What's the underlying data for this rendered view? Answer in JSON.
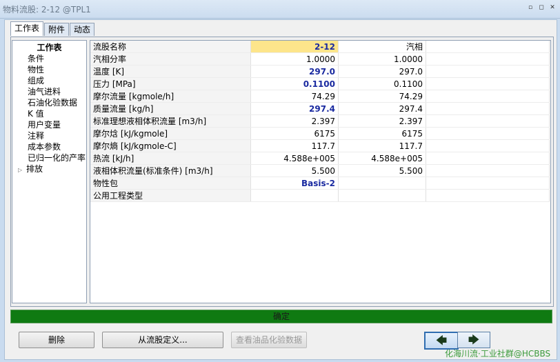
{
  "window": {
    "title": "物料流股: 2-12 @TPL1",
    "min": "▫",
    "restore": "◻",
    "close": "✕"
  },
  "tabs": [
    {
      "label": "工作表"
    },
    {
      "label": "附件"
    },
    {
      "label": "动态"
    }
  ],
  "tree": {
    "header": "工作表",
    "items": [
      "条件",
      "物性",
      "组成",
      "油气进料",
      "石油化验数据",
      "K 值",
      "用户变量",
      "注释",
      "成本参数",
      "已归一化的产率",
      "排放"
    ]
  },
  "grid": {
    "rows": [
      {
        "label": "流股名称",
        "v1": "2-12",
        "v2": "汽相"
      },
      {
        "label": "汽相分率",
        "v1": "1.0000",
        "v2": "1.0000"
      },
      {
        "label": "温度 [K]",
        "v1": "297.0",
        "v2": "297.0"
      },
      {
        "label": "压力 [MPa]",
        "v1": "0.1100",
        "v2": "0.1100"
      },
      {
        "label": "摩尔流量 [kgmole/h]",
        "v1": "74.29",
        "v2": "74.29"
      },
      {
        "label": "质量流量 [kg/h]",
        "v1": "297.4",
        "v2": "297.4"
      },
      {
        "label": "标准理想液相体积流量 [m3/h]",
        "v1": "2.397",
        "v2": "2.397"
      },
      {
        "label": "摩尔焓 [kJ/kgmole]",
        "v1": "6175",
        "v2": "6175"
      },
      {
        "label": "摩尔熵 [kJ/kgmole-C]",
        "v1": "117.7",
        "v2": "117.7"
      },
      {
        "label": "热流 [kJ/h]",
        "v1": "4.588e+005",
        "v2": "4.588e+005"
      },
      {
        "label": "液相体积流量(标准条件) [m3/h]",
        "v1": "5.500",
        "v2": "5.500"
      },
      {
        "label": "物性包",
        "v1": "Basis-2",
        "v2": ""
      },
      {
        "label": "公用工程类型",
        "v1": "",
        "v2": ""
      }
    ]
  },
  "status": {
    "text": "确定",
    "color": "#0f7a12"
  },
  "buttons": {
    "delete": "删除",
    "define_from_stream": "从流股定义...",
    "view_assay": "查看油品化验数据"
  },
  "nav": {
    "prev": "🡄",
    "next": "🡆"
  },
  "watermark": "化海川流·工业社群@HCBBS"
}
